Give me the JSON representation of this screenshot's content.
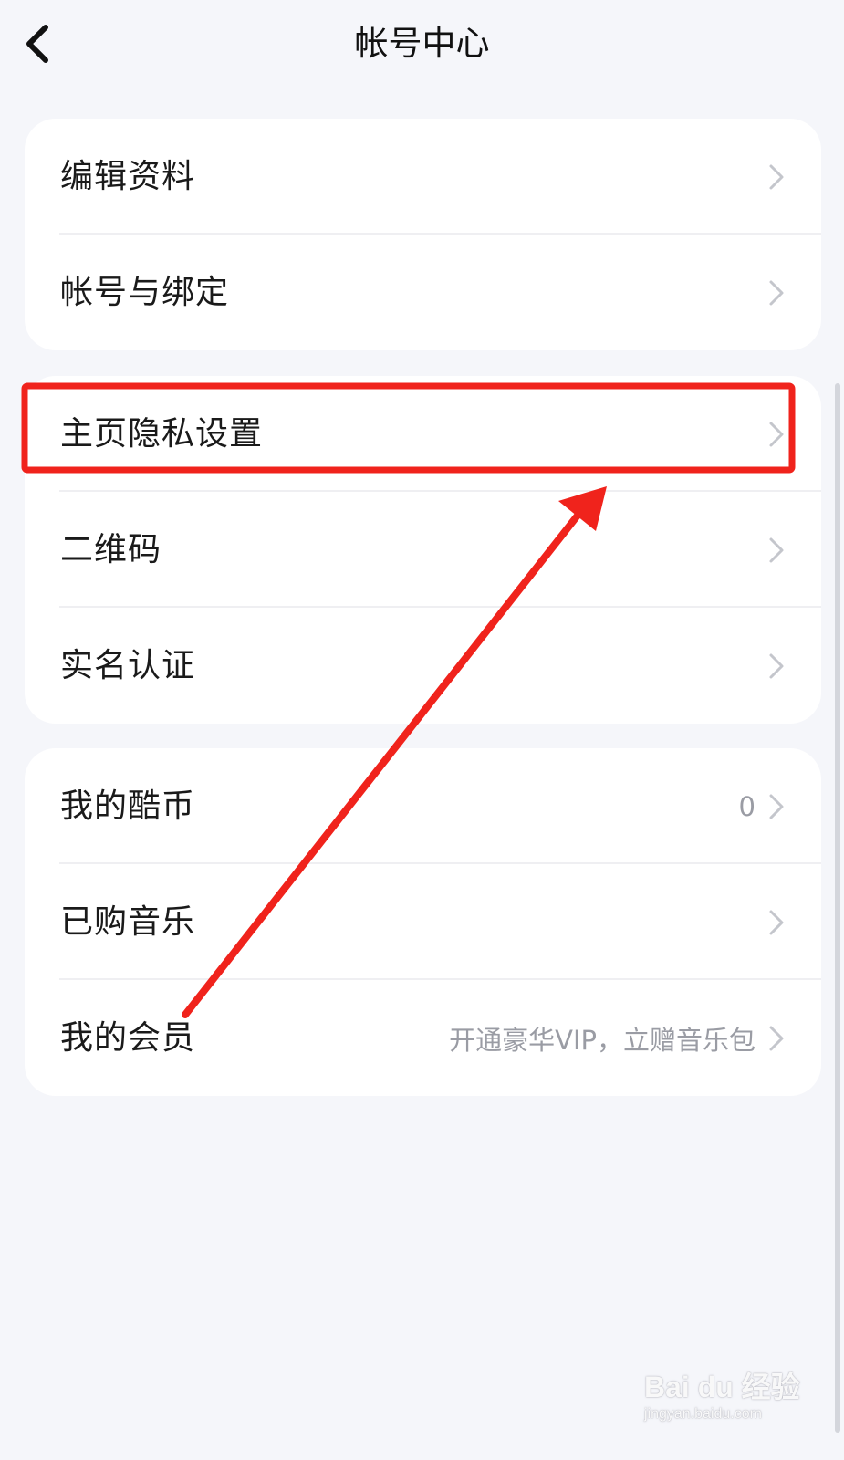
{
  "header": {
    "title": "帐号中心",
    "back_icon": "chevron-left-icon"
  },
  "groups": [
    {
      "items": [
        {
          "label": "编辑资料",
          "value": ""
        },
        {
          "label": "帐号与绑定",
          "value": ""
        }
      ]
    },
    {
      "items": [
        {
          "label": "主页隐私设置",
          "value": ""
        },
        {
          "label": "二维码",
          "value": ""
        },
        {
          "label": "实名认证",
          "value": ""
        }
      ]
    },
    {
      "items": [
        {
          "label": "我的酷币",
          "value": "0"
        },
        {
          "label": "已购音乐",
          "value": ""
        },
        {
          "label": "我的会员",
          "value": "开通豪华VIP，立赠音乐包"
        }
      ]
    }
  ],
  "annotation": {
    "highlight_color": "#f0231c",
    "arrow_color": "#f0231c"
  },
  "watermark": {
    "logo": "Bai du 经验",
    "url": "jingyan.baidu.com"
  },
  "colors": {
    "background": "#f5f6fa",
    "card": "#ffffff",
    "secondary_text": "#9a9ca4",
    "chevron": "#c4c6cc"
  }
}
